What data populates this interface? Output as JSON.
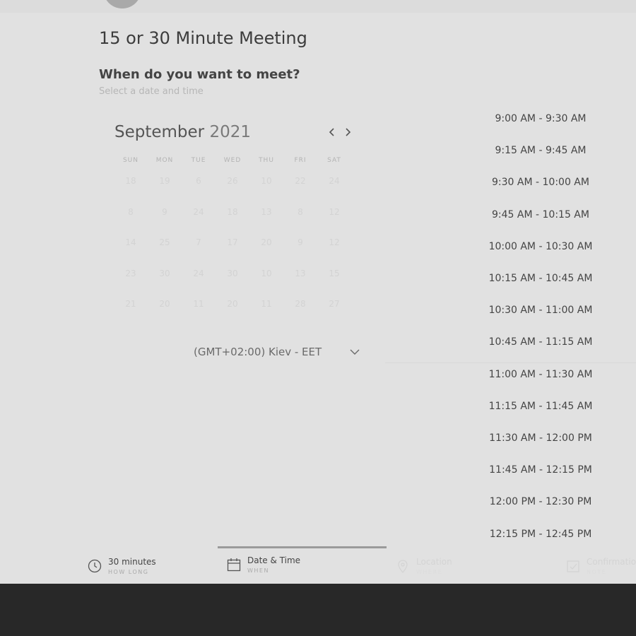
{
  "header": {
    "title_partial": ""
  },
  "meeting": {
    "title": "15 or 30 Minute Meeting",
    "question": "When do you want to meet?",
    "subtitle": "Select a date and time"
  },
  "calendar": {
    "month": "September",
    "year": "2021",
    "weekdays": [
      "SUN",
      "MON",
      "TUE",
      "WED",
      "THU",
      "FRI",
      "SAT"
    ],
    "weeks": [
      [
        "18",
        "19",
        "6",
        "26",
        "10",
        "22",
        "24"
      ],
      [
        "8",
        "9",
        "24",
        "18",
        "13",
        "8",
        "12"
      ],
      [
        "14",
        "25",
        "7",
        "17",
        "20",
        "9",
        "12"
      ],
      [
        "23",
        "30",
        "24",
        "30",
        "10",
        "13",
        "15"
      ],
      [
        "21",
        "20",
        "11",
        "20",
        "11",
        "28",
        "27"
      ]
    ]
  },
  "timezone": {
    "label": "(GMT+02:00) Kiev - EET"
  },
  "slots": [
    "9:00 AM - 9:30 AM",
    "9:15 AM - 9:45 AM",
    "9:30 AM - 10:00 AM",
    "9:45 AM - 10:15 AM",
    "10:00 AM - 10:30 AM",
    "10:15 AM - 10:45 AM",
    "10:30 AM - 11:00 AM",
    "10:45 AM - 11:15 AM",
    "11:00 AM - 11:30 AM",
    "11:15 AM - 11:45 AM",
    "11:30 AM - 12:00 PM",
    "11:45 AM - 12:15 PM",
    "12:00 PM - 12:30 PM",
    "12:15 PM - 12:45 PM"
  ],
  "steps": [
    {
      "label": "30 minutes",
      "sub": "HOW LONG",
      "icon": "clock-icon"
    },
    {
      "label": "Date & Time",
      "sub": "WHEN",
      "icon": "calendar-icon"
    },
    {
      "label": "Location",
      "sub": "WHERE",
      "icon": "location-pin-icon"
    },
    {
      "label": "Confirmation",
      "sub": "NOTE",
      "icon": "confirmation-icon"
    }
  ],
  "colors": {
    "background": "#e1e1e1",
    "footer": "#282828",
    "active_step": "#9a9a9a"
  }
}
